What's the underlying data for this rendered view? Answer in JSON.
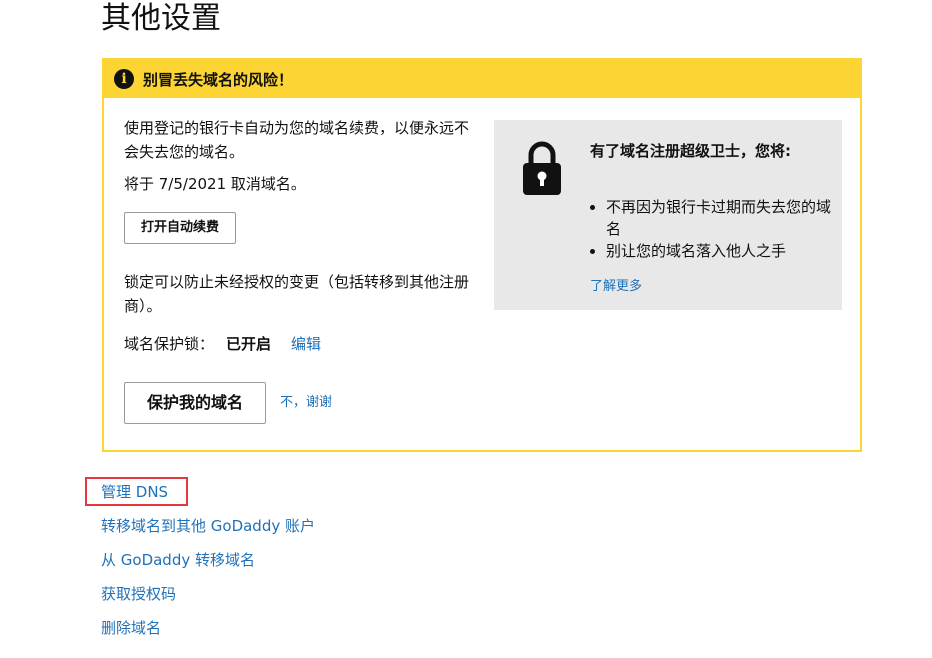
{
  "page": {
    "title": "其他设置"
  },
  "alert": {
    "title": "别冒丢失域名的风险！",
    "description": "使用登记的银行卡自动为您的域名续费，以便永远不会失去您的域名。",
    "cancel_note": "将于 7/5/2021 取消域名。",
    "autorenew_button": "打开自动续费",
    "lock_description": "锁定可以防止未经授权的变更（包括转移到其他注册商）。",
    "lock_label": "域名保护锁：",
    "lock_status": "已开启",
    "edit_link": "编辑",
    "protect_button": "保护我的域名",
    "no_thanks": "不，谢谢"
  },
  "promo": {
    "title": "有了域名注册超级卫士，您将:",
    "bullets": [
      "不再因为银行卡过期而失去您的域名",
      "别让您的域名落入他人之手"
    ],
    "learn_more": "了解更多"
  },
  "links": [
    "管理 DNS",
    "转移域名到其他 GoDaddy 账户",
    "从 GoDaddy 转移域名",
    "获取授权码",
    "删除域名"
  ],
  "colors": {
    "accent_yellow": "#fcd534",
    "link_blue": "#1f71b8",
    "highlight_red": "#e0393e",
    "promo_gray": "#e8e8e8"
  },
  "icons": {
    "alert": "info-icon",
    "promo": "lock-icon"
  }
}
